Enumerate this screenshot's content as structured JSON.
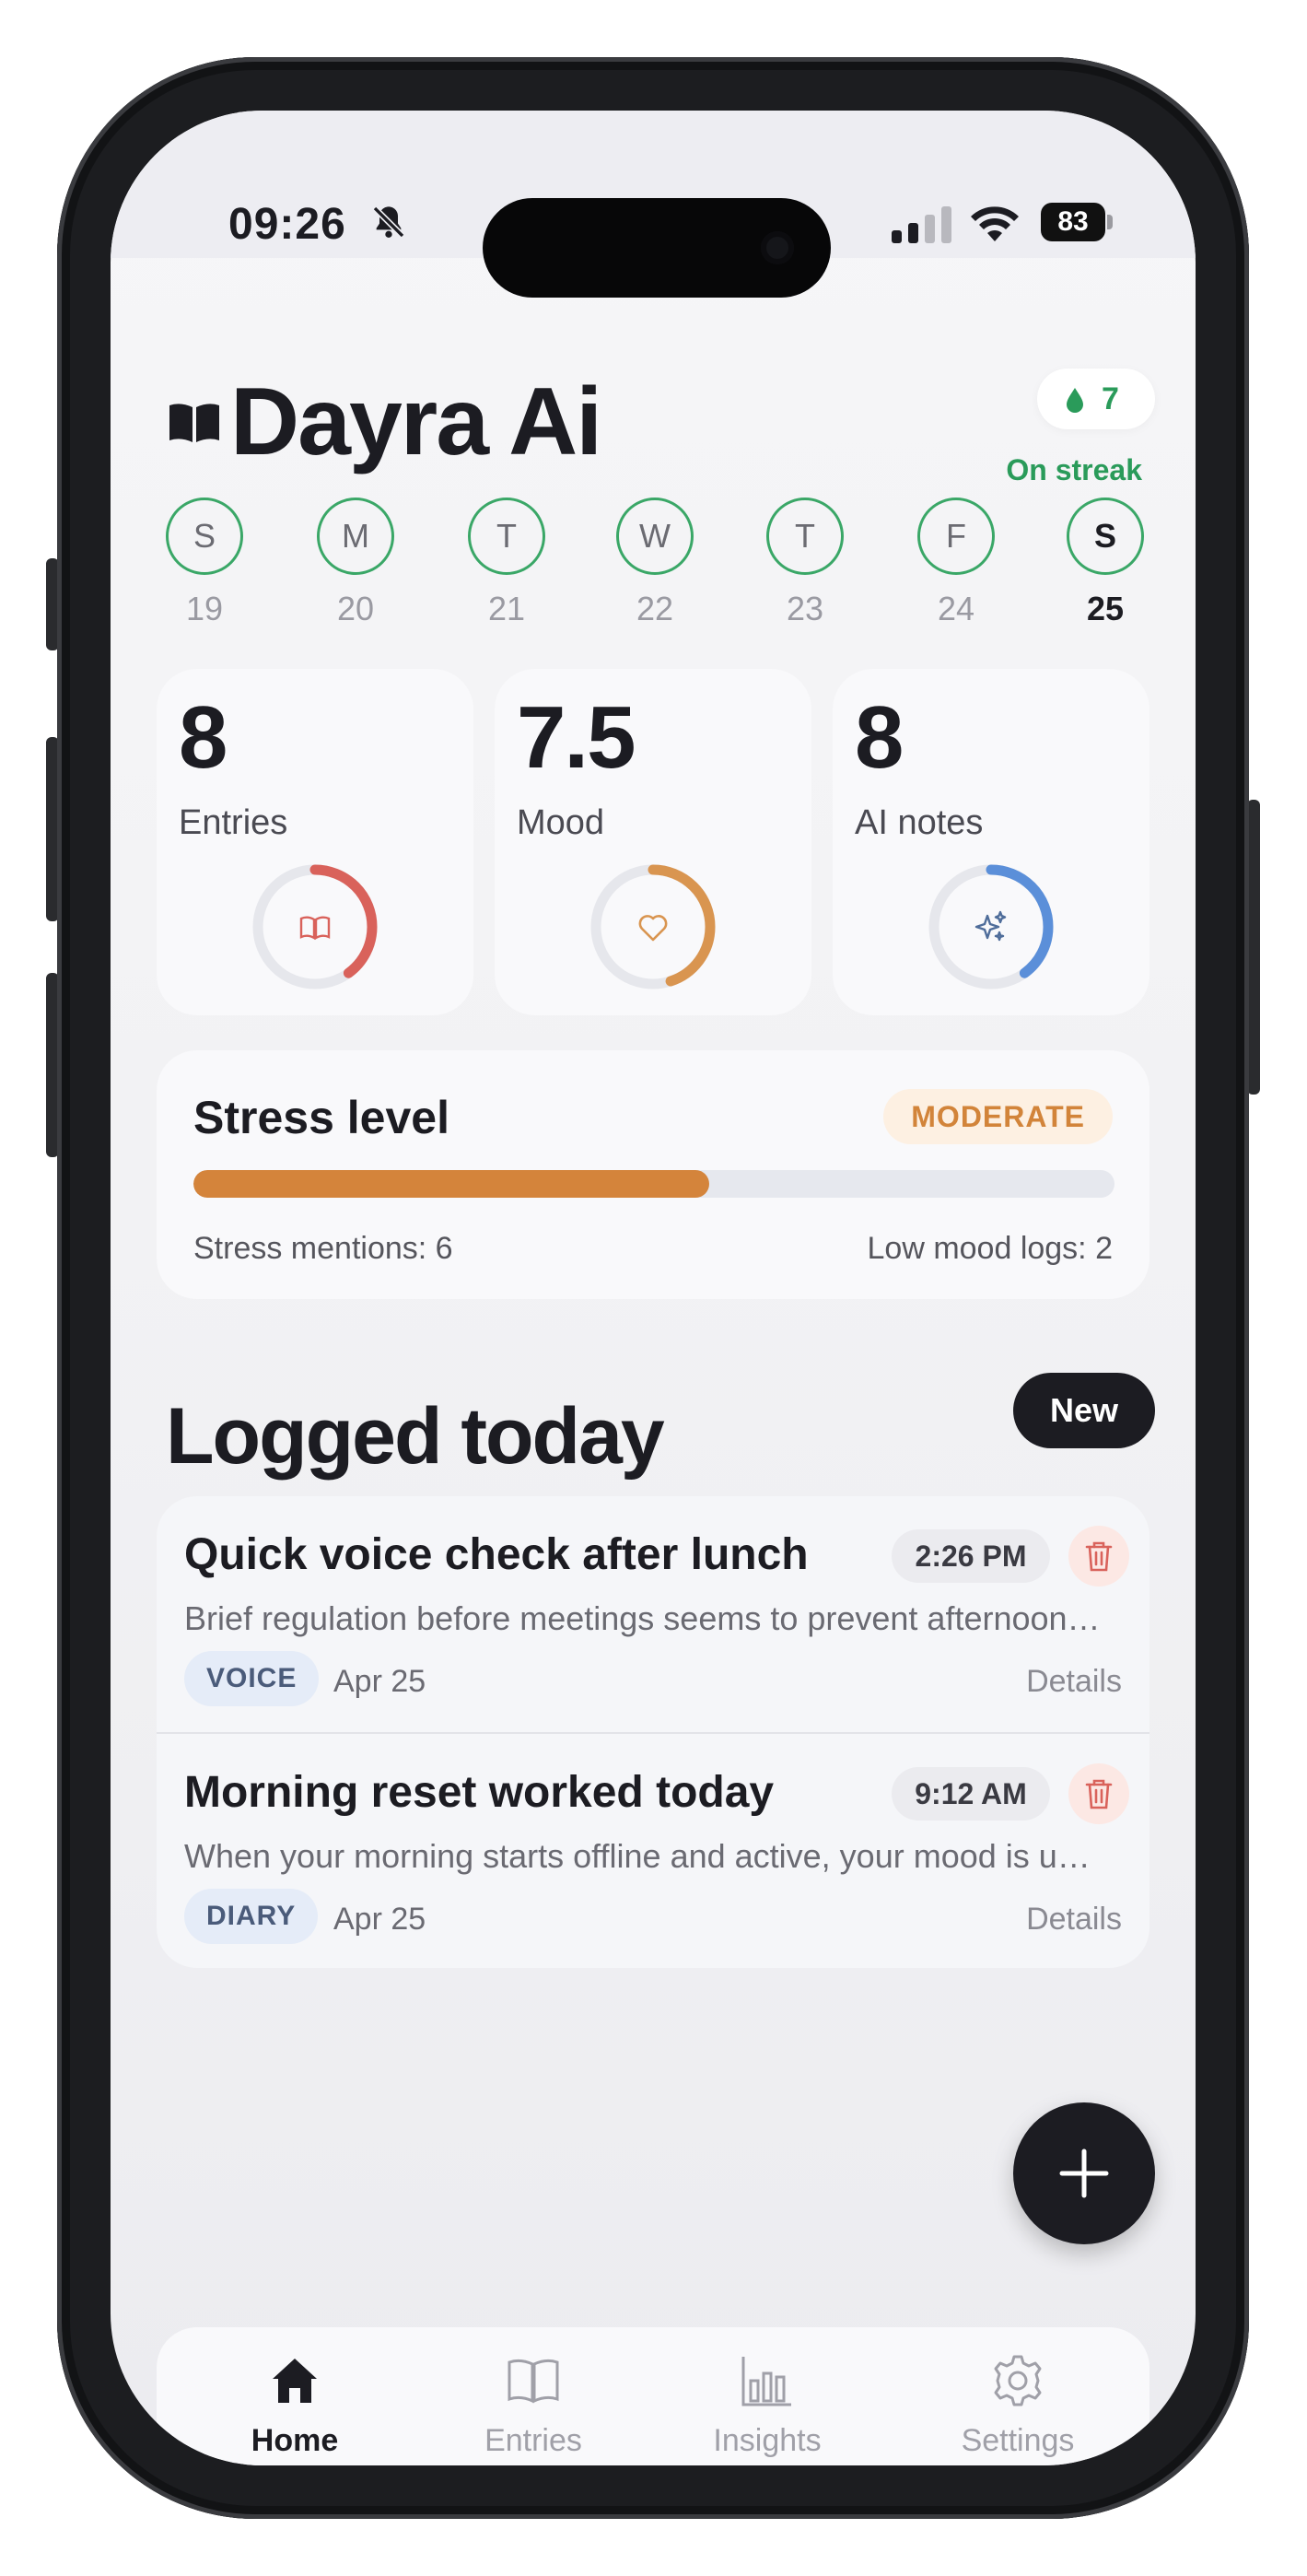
{
  "status_bar": {
    "time": "09:26",
    "battery": "83"
  },
  "header": {
    "title": "Dayra Ai",
    "streak_count": "7",
    "streak_label": "On streak"
  },
  "week": [
    {
      "letter": "S",
      "date": "19",
      "active": false
    },
    {
      "letter": "M",
      "date": "20",
      "active": false
    },
    {
      "letter": "T",
      "date": "21",
      "active": false
    },
    {
      "letter": "W",
      "date": "22",
      "active": false
    },
    {
      "letter": "T",
      "date": "23",
      "active": false
    },
    {
      "letter": "F",
      "date": "24",
      "active": false
    },
    {
      "letter": "S",
      "date": "25",
      "active": true
    }
  ],
  "stats": [
    {
      "value": "8",
      "label": "Entries",
      "icon": "book-icon",
      "color": "#d9625b",
      "progress": 0.4
    },
    {
      "value": "7.5",
      "label": "Mood",
      "icon": "heart-icon",
      "color": "#d99550",
      "progress": 0.45
    },
    {
      "value": "8",
      "label": "AI notes",
      "icon": "sparkles-icon",
      "color": "#5b8fd9",
      "progress": 0.4
    }
  ],
  "stress": {
    "title": "Stress level",
    "badge": "MODERATE",
    "progress": 0.56,
    "mentions": "Stress mentions: 6",
    "low_mood": "Low mood logs: 2"
  },
  "logged_today": {
    "title": "Logged today",
    "new_label": "New",
    "entries": [
      {
        "title": "Quick voice check after lunch",
        "time": "2:26 PM",
        "preview": "Brief regulation before meetings seems to prevent afternoon…",
        "tag": "VOICE",
        "date": "Apr 25",
        "details": "Details"
      },
      {
        "title": "Morning reset worked today",
        "time": "9:12 AM",
        "preview": "When your morning starts offline and active, your mood is u…",
        "tag": "DIARY",
        "date": "Apr 25",
        "details": "Details"
      }
    ]
  },
  "tabs": [
    {
      "label": "Home",
      "icon": "home-icon",
      "active": true
    },
    {
      "label": "Entries",
      "icon": "book-icon",
      "active": false
    },
    {
      "label": "Insights",
      "icon": "bar-chart-icon",
      "active": false
    },
    {
      "label": "Settings",
      "icon": "gear-icon",
      "active": false
    }
  ],
  "colors": {
    "accent_green": "#2a9b5a",
    "stress_orange": "#d4843b",
    "dark": "#1c1c22"
  }
}
